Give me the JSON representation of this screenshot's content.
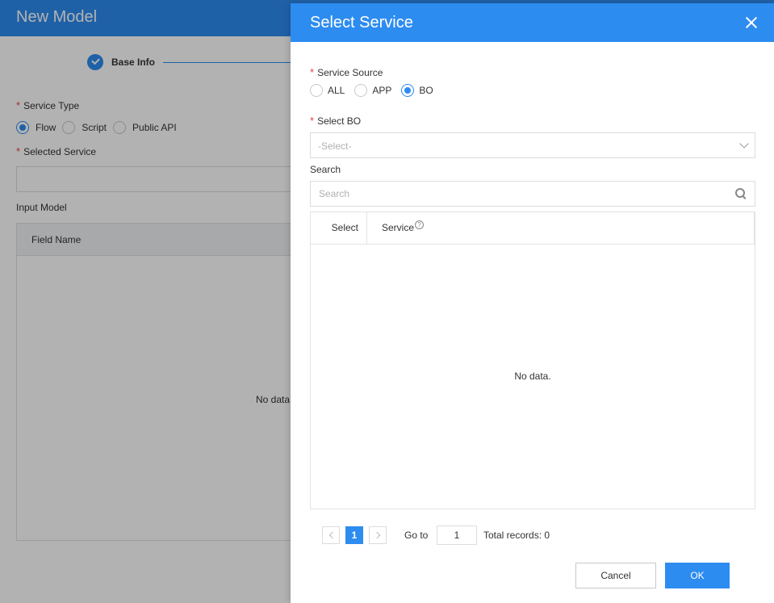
{
  "background": {
    "title": "New Model",
    "step": {
      "label": "Base Info"
    },
    "service_type": {
      "label": "Service Type",
      "options": [
        "Flow",
        "Script",
        "Public API"
      ],
      "selected": "Flow"
    },
    "selected_service": {
      "label": "Selected Service",
      "value": ""
    },
    "input_model": {
      "label": "Input Model",
      "column": "Field Name",
      "empty_text": "No data."
    }
  },
  "dialog": {
    "title": "Select Service",
    "service_source": {
      "label": "Service Source",
      "options": [
        "ALL",
        "APP",
        "BO"
      ],
      "selected": "BO"
    },
    "select_bo": {
      "label": "Select BO",
      "placeholder": "-Select-"
    },
    "search": {
      "label": "Search",
      "placeholder": "Search"
    },
    "table": {
      "columns": [
        "Select",
        "Service"
      ],
      "help_glyph": "?",
      "empty_text": "No data."
    },
    "pagination": {
      "current_page": "1",
      "goto_label": "Go to",
      "goto_value": "1",
      "total_text": "Total records: 0"
    },
    "buttons": {
      "cancel": "Cancel",
      "ok": "OK"
    }
  },
  "colors": {
    "primary": "#2d8cf0",
    "required": "#e64545",
    "overlay": "rgba(0,0,0,0.30)"
  }
}
